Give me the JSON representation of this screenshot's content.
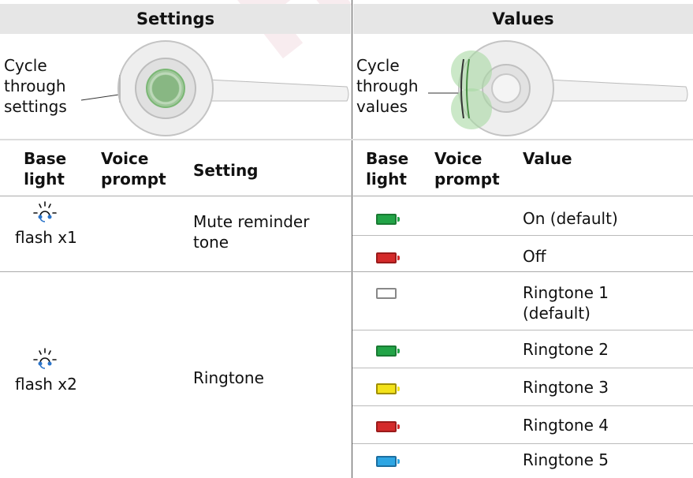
{
  "header": {
    "settings": "Settings",
    "values": "Values"
  },
  "figure_left": {
    "caption_lines": [
      "Cycle",
      "through",
      "settings"
    ]
  },
  "figure_right": {
    "caption_lines": [
      "Cycle",
      "through",
      "values"
    ]
  },
  "left_columns": {
    "base_light": [
      "Base",
      "light"
    ],
    "voice_prompt": [
      "Voice",
      "prompt"
    ],
    "setting": "Setting"
  },
  "right_columns": {
    "base_light": [
      "Base",
      "light"
    ],
    "voice_prompt": [
      "Voice",
      "prompt"
    ],
    "value": "Value"
  },
  "rows": [
    {
      "flash": "flash x1",
      "setting": [
        "Mute reminder",
        "tone"
      ],
      "values": [
        {
          "battery_color": "#22a447",
          "label": [
            "On (default)"
          ]
        },
        {
          "battery_color": "#d42a2a",
          "label": [
            "Off"
          ]
        }
      ]
    },
    {
      "flash": "flash x2",
      "setting": [
        "Ringtone"
      ],
      "values": [
        {
          "battery_color": "#ffffff",
          "label": [
            "Ringtone 1",
            "(default)"
          ]
        },
        {
          "battery_color": "#22a447",
          "label": [
            "Ringtone 2"
          ]
        },
        {
          "battery_color": "#f3e21a",
          "label": [
            "Ringtone 3"
          ]
        },
        {
          "battery_color": "#d42a2a",
          "label": [
            "Ringtone 4"
          ]
        },
        {
          "battery_color": "#2ea6e3",
          "label": [
            "Ringtone 5"
          ]
        }
      ]
    }
  ],
  "watermark": "Head"
}
